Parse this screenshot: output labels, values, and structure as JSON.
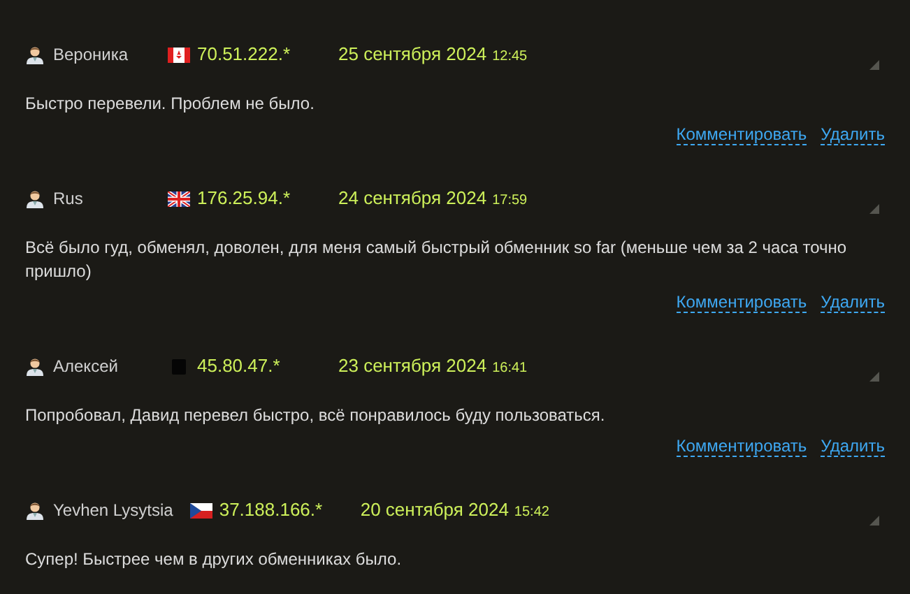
{
  "comments": [
    {
      "author": "Вероника",
      "flag": {
        "kind": "ca"
      },
      "ip": "70.51.222.*",
      "date": "25 сентября 2024",
      "time": "12:45",
      "text": "Быстро перевели. Проблем не было.",
      "actions": [
        "Комментировать",
        "Удалить"
      ]
    },
    {
      "author": "Rus",
      "flag": {
        "kind": "gb"
      },
      "ip": "176.25.94.*",
      "date": "24 сентября 2024",
      "time": "17:59",
      "text": "Всё было гуд, обменял, доволен, для меня самый быстрый обменник so far (меньше чем за 2 часа точно пришло)",
      "actions": [
        "Комментировать",
        "Удалить"
      ]
    },
    {
      "author": "Алексей",
      "flag": {
        "kind": "unknown"
      },
      "ip": "45.80.47.*",
      "date": "23 сентября 2024",
      "time": "16:41",
      "text": "Попробовал, Давид перевел быстро, всё понравилось буду пользоваться.",
      "actions": [
        "Комментировать",
        "Удалить"
      ]
    },
    {
      "author": "Yevhen Lysytsia",
      "flag": {
        "kind": "cz"
      },
      "ip": "37.188.166.*",
      "date": "20 сентября 2024",
      "time": "15:42",
      "text": "Супер! Быстрее чем в других обменниках было."
    }
  ]
}
